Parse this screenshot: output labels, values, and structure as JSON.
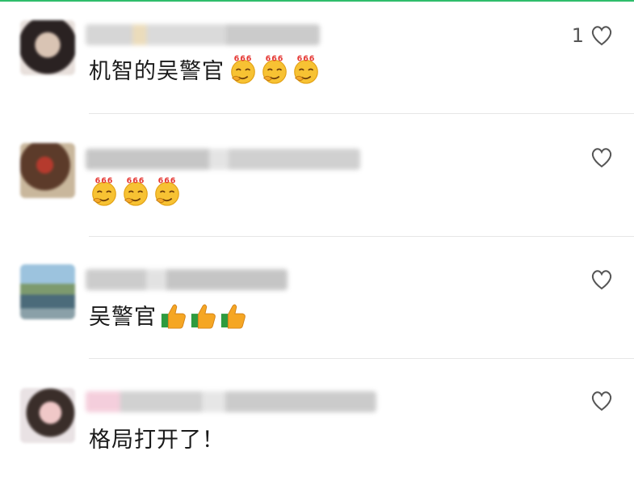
{
  "comments": [
    {
      "text": "机智的吴警官",
      "emoji": "666-emoji",
      "emoji_count": 3,
      "like_count": "1"
    },
    {
      "text": "",
      "emoji": "666-emoji",
      "emoji_count": 3,
      "like_count": ""
    },
    {
      "text": "吴警官",
      "emoji": "thumbs-up-emoji",
      "emoji_count": 3,
      "like_count": ""
    },
    {
      "text": "格局打开了！",
      "emoji": "",
      "emoji_count": 0,
      "like_count": ""
    }
  ],
  "colors": {
    "accent_line": "#2ebd6b",
    "text": "#1a1a1a",
    "icon": "#555555",
    "divider": "#e6e6e6"
  },
  "icons": {
    "like": "heart-outline-icon"
  }
}
